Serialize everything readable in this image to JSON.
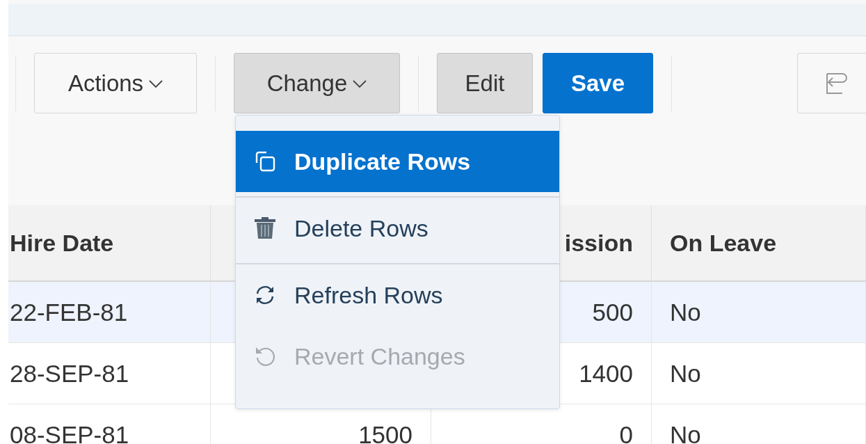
{
  "toolbar": {
    "buttons": [
      {
        "label": "Actions",
        "kind": "menu",
        "pressed": false
      },
      {
        "label": "Change",
        "kind": "menu",
        "pressed": true
      },
      {
        "label": "Edit",
        "kind": "plain",
        "pressed": true
      },
      {
        "label": "Save",
        "kind": "primary",
        "pressed": false
      },
      {
        "kind": "icon",
        "pressed": false
      }
    ]
  },
  "menu": {
    "items": [
      {
        "label": "Duplicate Rows",
        "selected": true,
        "disabled": false
      },
      {
        "label": "Delete Rows",
        "selected": false,
        "disabled": false
      },
      {
        "label": "Refresh Rows",
        "selected": false,
        "disabled": false
      },
      {
        "label": "Revert Changes",
        "selected": false,
        "disabled": true
      }
    ]
  },
  "table": {
    "columns": [
      {
        "label": "Hire Date"
      },
      {},
      {
        "label": "ission"
      },
      {
        "label": "On Leave"
      }
    ],
    "rows": [
      {
        "selected": true,
        "cells": [
          "22-FEB-81",
          "",
          "500",
          "No"
        ]
      },
      {
        "selected": false,
        "cells": [
          "28-SEP-81",
          "",
          "1400",
          "No"
        ]
      },
      {
        "selected": false,
        "cells": [
          "08-SEP-81",
          "1500",
          "0",
          "No"
        ]
      }
    ]
  }
}
